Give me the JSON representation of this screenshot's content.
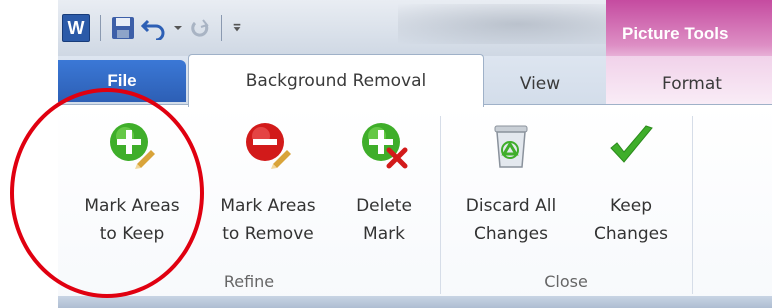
{
  "app": {
    "icon_letter": "W"
  },
  "quick_access": {
    "items": [
      {
        "icon": "word-icon"
      },
      {
        "icon": "save-icon"
      },
      {
        "icon": "undo-icon"
      },
      {
        "icon": "redo-icon"
      },
      {
        "icon": "customize-qat-icon"
      }
    ]
  },
  "context": {
    "group_label": "Picture Tools",
    "accent": "#c54ba0"
  },
  "tabs": {
    "file": "File",
    "items": [
      {
        "label": "Background Removal",
        "active": true
      },
      {
        "label": "View",
        "active": false
      },
      {
        "label": "Format",
        "active": false
      }
    ]
  },
  "ribbon": {
    "groups": [
      {
        "label": "Refine",
        "commands": [
          {
            "label": "Mark Areas\nto Keep",
            "icon": "mark-keep-icon"
          },
          {
            "label": "Mark Areas\nto Remove",
            "icon": "mark-remove-icon"
          },
          {
            "label": "Delete\nMark",
            "icon": "delete-mark-icon"
          }
        ]
      },
      {
        "label": "Close",
        "commands": [
          {
            "label": "Discard All\nChanges",
            "icon": "discard-icon"
          },
          {
            "label": "Keep\nChanges",
            "icon": "checkmark-icon"
          }
        ]
      }
    ]
  },
  "annotation": {
    "color": "#e00010"
  }
}
